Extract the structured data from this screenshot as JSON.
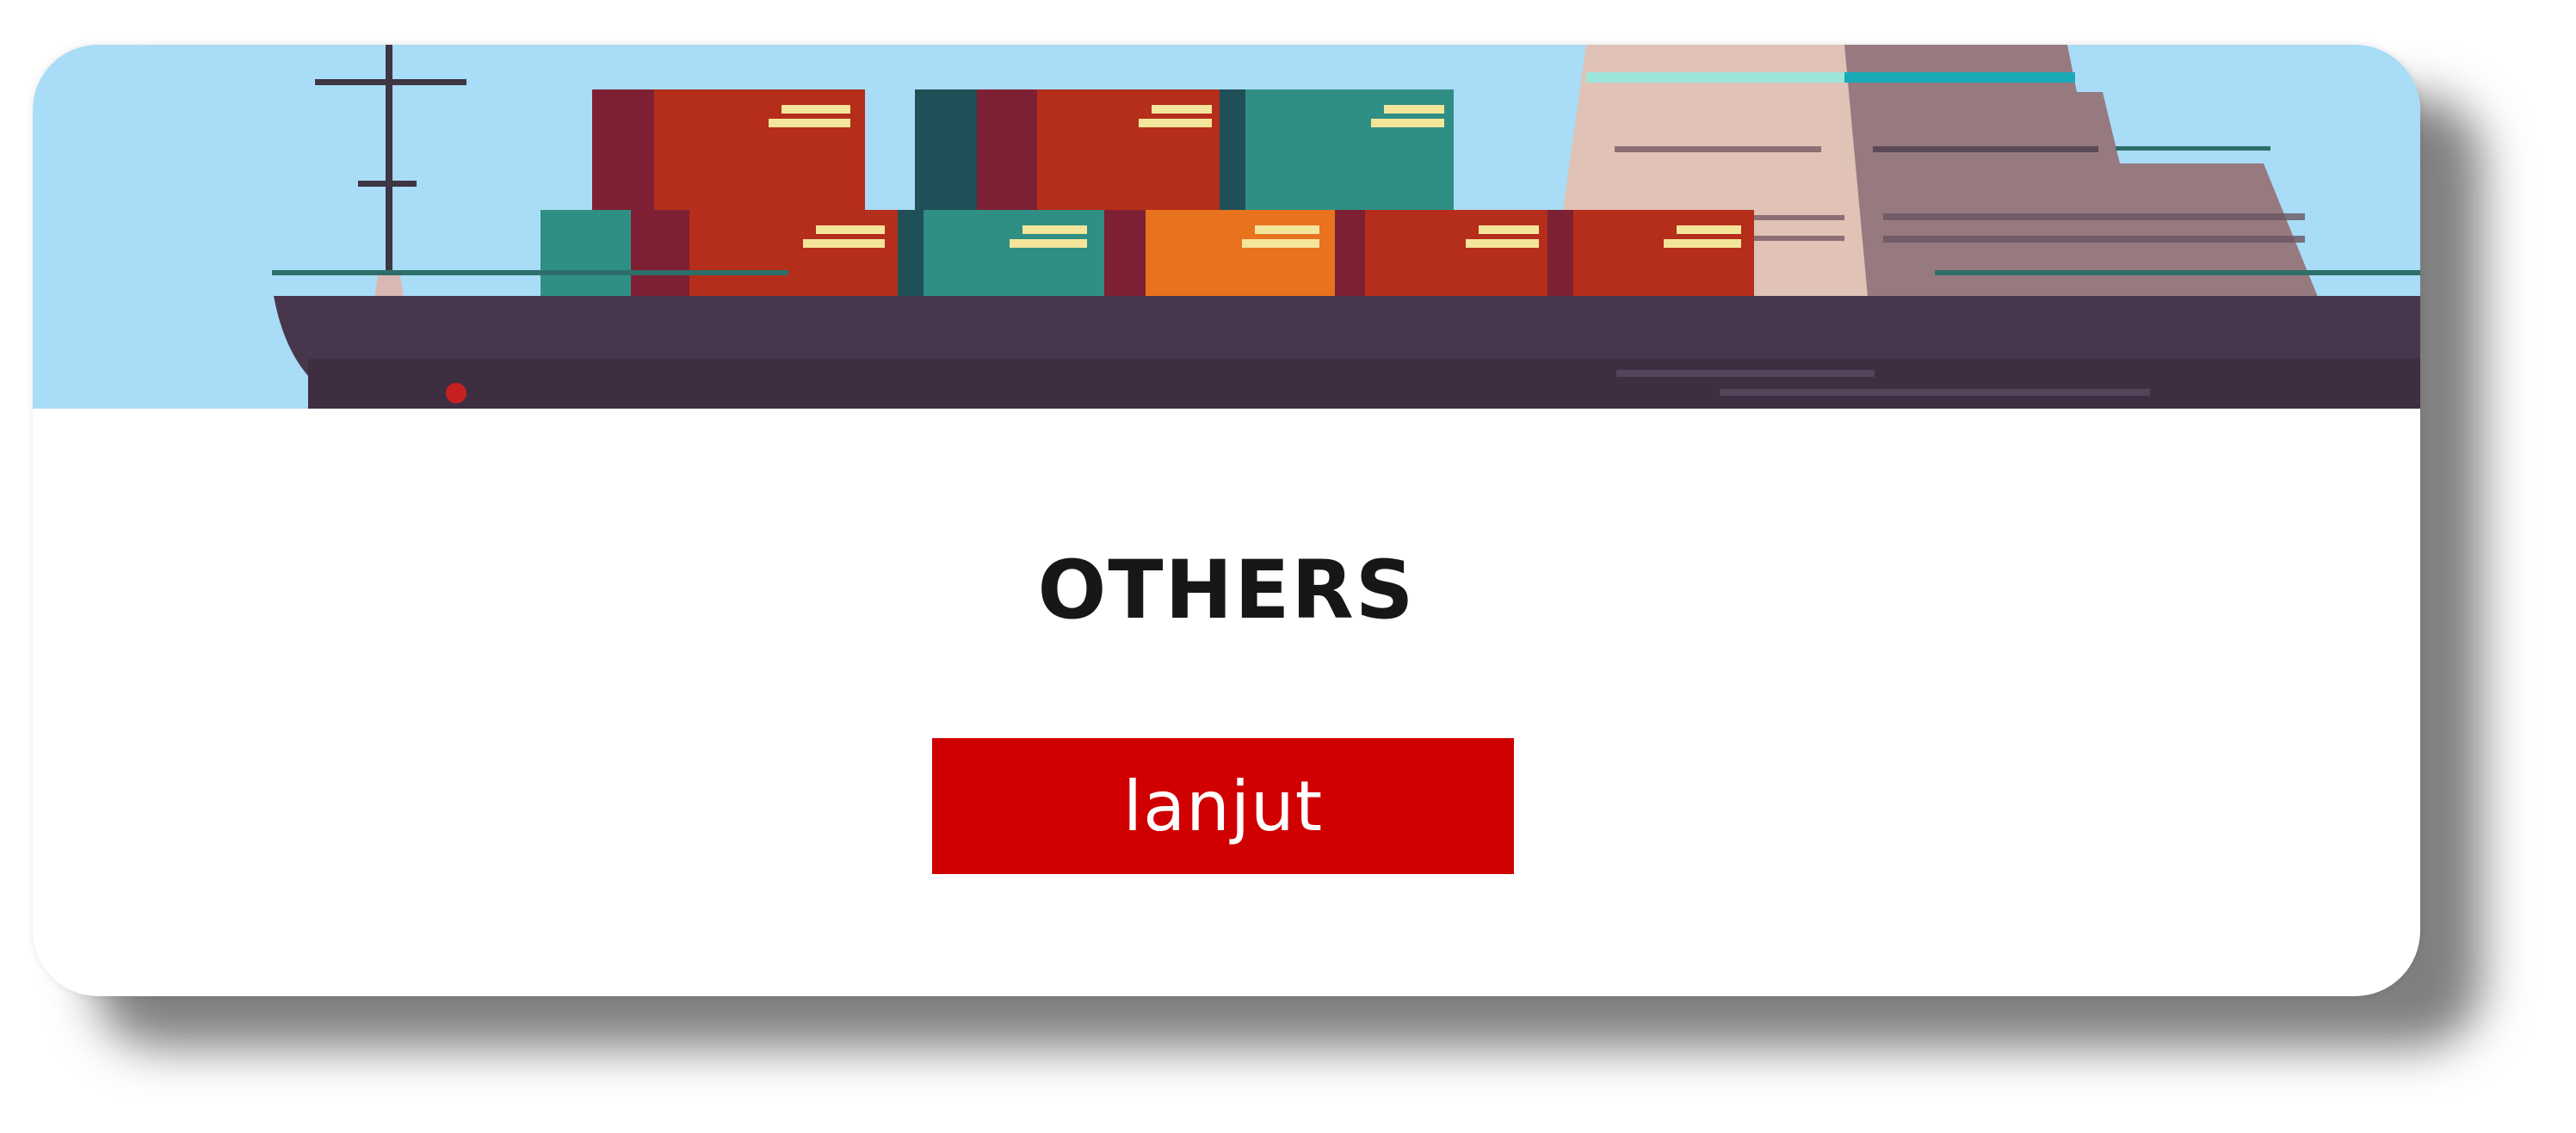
{
  "card": {
    "title": "OTHERS",
    "button_label": "lanjut"
  },
  "banner": {
    "illustration": "cargo-ship-with-containers",
    "colors": {
      "sky": "#a9dcf6",
      "hull": "#48364d",
      "container_red": "#b52d1b",
      "container_teal": "#2f8f84",
      "container_orange": "#e8721e",
      "superstructure": "#e0c2b6"
    }
  },
  "colors": {
    "button": "#d10000",
    "title": "#171717"
  }
}
